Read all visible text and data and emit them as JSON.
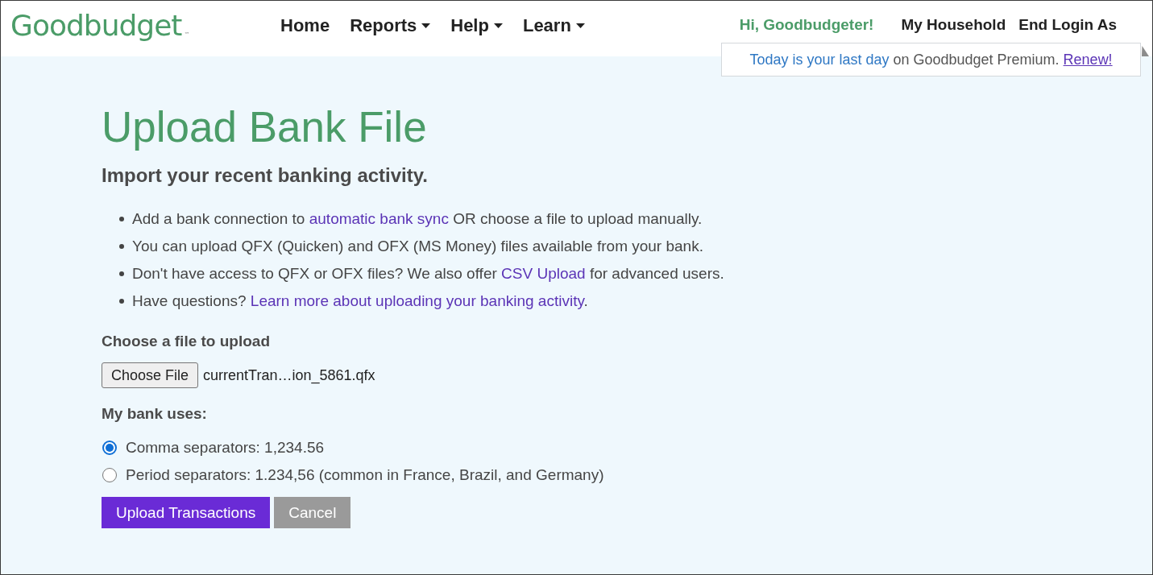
{
  "header": {
    "logo": "Goodbudget",
    "logo_mark": "™",
    "nav": [
      {
        "label": "Home",
        "dropdown": false
      },
      {
        "label": "Reports",
        "dropdown": true
      },
      {
        "label": "Help",
        "dropdown": true
      },
      {
        "label": "Learn",
        "dropdown": true
      }
    ],
    "greeting": "Hi, Goodbudgeter!",
    "links": [
      "My Household",
      "End Login As"
    ]
  },
  "notice": {
    "segments": [
      {
        "kind": "highlight",
        "text": "Today is your last day"
      },
      {
        "kind": "text",
        "text": " on Goodbudget Premium. "
      },
      {
        "kind": "link",
        "text": "Renew!"
      }
    ]
  },
  "page": {
    "title": "Upload Bank File",
    "subtitle": "Import your recent banking activity.",
    "bullets": [
      {
        "segments": [
          {
            "kind": "text",
            "text": "Add a bank connection to "
          },
          {
            "kind": "link",
            "text": "automatic bank sync"
          },
          {
            "kind": "text",
            "text": " OR choose a file to upload manually."
          }
        ]
      },
      {
        "segments": [
          {
            "kind": "text",
            "text": "You can upload QFX (Quicken) and OFX (MS Money) files available from your bank."
          }
        ]
      },
      {
        "segments": [
          {
            "kind": "text",
            "text": "Don't have access to QFX or OFX files? We also offer "
          },
          {
            "kind": "link",
            "text": "CSV Upload"
          },
          {
            "kind": "text",
            "text": " for advanced users."
          }
        ]
      },
      {
        "segments": [
          {
            "kind": "text",
            "text": "Have questions? "
          },
          {
            "kind": "link",
            "text": "Learn more about uploading your banking activity"
          },
          {
            "kind": "text",
            "text": "."
          }
        ]
      }
    ]
  },
  "file_upload": {
    "label": "Choose a file to upload",
    "button": "Choose File",
    "file_name": "currentTran…ion_5861.qfx"
  },
  "separators": {
    "label": "My bank uses:",
    "options": [
      {
        "label": "Comma separators: 1,234.56",
        "selected": true
      },
      {
        "label": "Period separators: 1.234,56 (common in France, Brazil, and Germany)",
        "selected": false
      }
    ]
  },
  "actions": [
    {
      "label": "Upload Transactions",
      "kind": "primary"
    },
    {
      "label": "Cancel",
      "kind": "secondary"
    }
  ]
}
